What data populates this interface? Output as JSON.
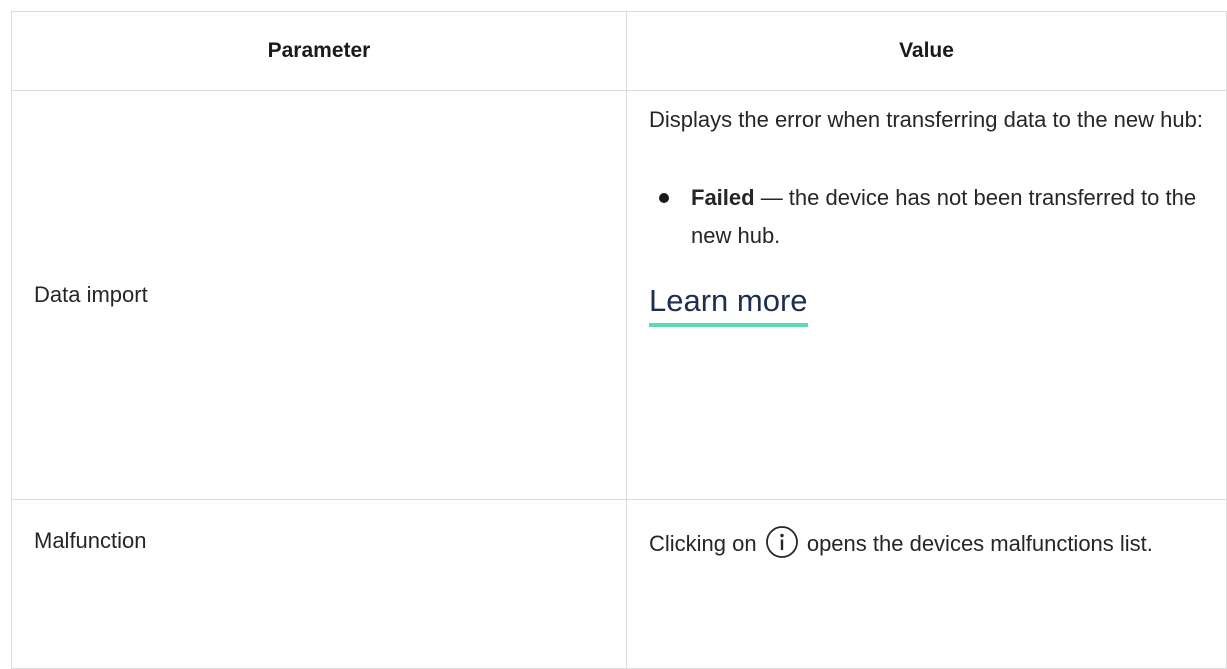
{
  "table": {
    "headers": {
      "parameter": "Parameter",
      "value": "Value"
    },
    "rows": [
      {
        "parameter": "Data import",
        "description": "Displays the error when transferring data to the new hub:",
        "bullet_term": "Failed",
        "bullet_text": " — the device has not been transferred to the new hub.",
        "link_label": "Learn more",
        "link_underline_color": "#5cdcad"
      },
      {
        "parameter": "Malfunction",
        "text_before_icon": "Clicking on ",
        "icon": "info-circle-icon",
        "text_after_icon": " opens the devices malfunctions list."
      }
    ]
  },
  "colors": {
    "border": "#dcdcdc",
    "link_text": "#1c2f52",
    "link_accent": "#5cdcad"
  }
}
